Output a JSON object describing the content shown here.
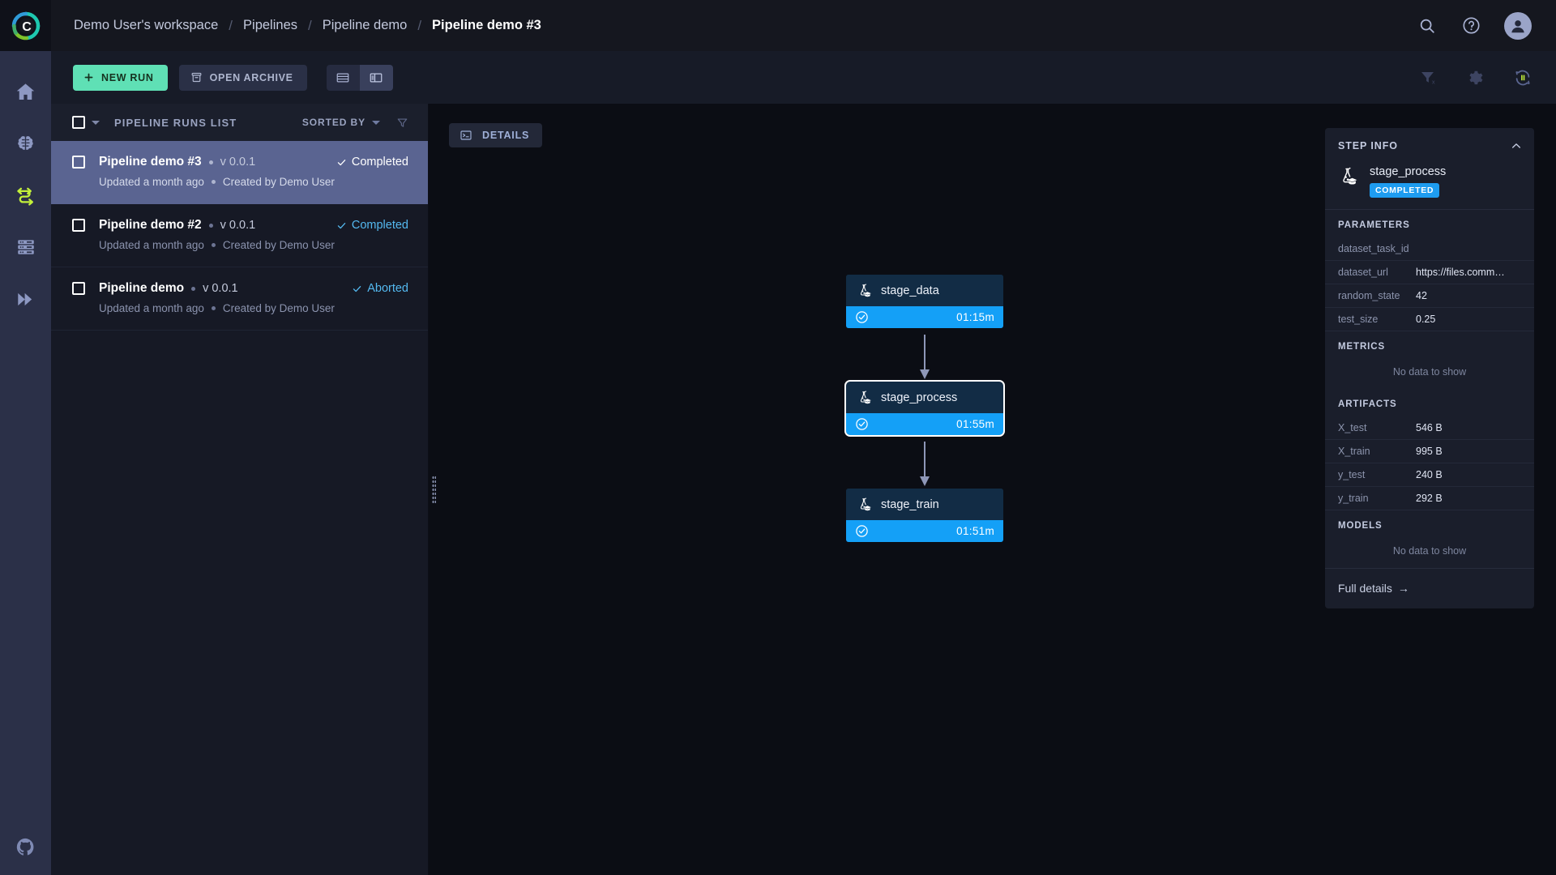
{
  "topbar": {
    "breadcrumb": [
      {
        "label": "Demo User's workspace",
        "current": false
      },
      {
        "label": "Pipelines",
        "current": false
      },
      {
        "label": "Pipeline demo",
        "current": false
      },
      {
        "label": "Pipeline demo #3",
        "current": true
      }
    ],
    "separator": "/",
    "icons": {
      "search": "search-icon",
      "help": "help-circle-icon",
      "avatar": "user-avatar"
    }
  },
  "rail": {
    "items": [
      {
        "name": "home",
        "icon": "home-icon",
        "active": false
      },
      {
        "name": "experiments",
        "icon": "brain-icon",
        "active": false
      },
      {
        "name": "pipelines",
        "icon": "pipelines-icon",
        "active": true
      },
      {
        "name": "datasets",
        "icon": "server-stack-icon",
        "active": false
      },
      {
        "name": "reports",
        "icon": "double-chevron-right-icon",
        "active": false
      }
    ],
    "bottom": {
      "name": "github",
      "icon": "github-icon"
    },
    "accent": "#c3f03a"
  },
  "toolbar": {
    "new_run_label": "NEW RUN",
    "open_archive_label": "OPEN ARCHIVE",
    "view_toggles": [
      {
        "name": "list-view",
        "icon": "list-view-icon",
        "active": false
      },
      {
        "name": "split-view",
        "icon": "split-view-icon",
        "active": true
      }
    ],
    "right_icons": [
      {
        "name": "clear-filters",
        "icon": "filter-off-icon"
      },
      {
        "name": "settings",
        "icon": "gear-icon"
      },
      {
        "name": "auto-refresh-pause",
        "icon": "refresh-pause-icon"
      }
    ],
    "new_run_color": "#5fe0b5"
  },
  "runs_panel": {
    "title": "PIPELINE RUNS LIST",
    "sorted_by_label": "SORTED BY",
    "filter_icon": "filter-icon",
    "items": [
      {
        "name": "Pipeline demo #3",
        "version": "v 0.0.1",
        "status": "Completed",
        "status_kind": "completed",
        "updated": "Updated a month ago",
        "created": "Created by Demo User",
        "selected": true
      },
      {
        "name": "Pipeline demo #2",
        "version": "v 0.0.1",
        "status": "Completed",
        "status_kind": "completed",
        "updated": "Updated a month ago",
        "created": "Created by Demo User",
        "selected": false
      },
      {
        "name": "Pipeline demo",
        "version": "v 0.0.1",
        "status": "Aborted",
        "status_kind": "aborted",
        "updated": "Updated a month ago",
        "created": "Created by Demo User",
        "selected": false
      }
    ]
  },
  "graph": {
    "details_label": "DETAILS",
    "details_icon": "console-icon",
    "nodes": [
      {
        "label": "stage_data",
        "duration": "01:15m",
        "status_icon": "check-circle-icon",
        "active": false
      },
      {
        "label": "stage_process",
        "duration": "01:55m",
        "status_icon": "check-circle-icon",
        "active": true
      },
      {
        "label": "stage_train",
        "duration": "01:51m",
        "status_icon": "check-circle-icon",
        "active": false
      }
    ],
    "node_status_color": "#14a0f7"
  },
  "step_info": {
    "panel_title": "STEP INFO",
    "collapse_icon": "chevron-up-icon",
    "step_name": "stage_process",
    "step_icon": "flask-graduation-icon",
    "badge": "COMPLETED",
    "badge_color": "#1e9cf0",
    "parameters_title": "PARAMETERS",
    "parameters": [
      {
        "key": "dataset_task_id",
        "value": ""
      },
      {
        "key": "dataset_url",
        "value": "https://files.comm…"
      },
      {
        "key": "random_state",
        "value": "42"
      },
      {
        "key": "test_size",
        "value": "0.25"
      }
    ],
    "metrics_title": "METRICS",
    "metrics_empty": "No data to show",
    "artifacts_title": "ARTIFACTS",
    "artifacts": [
      {
        "key": "X_test",
        "value": "546 B"
      },
      {
        "key": "X_train",
        "value": "995 B"
      },
      {
        "key": "y_test",
        "value": "240 B"
      },
      {
        "key": "y_train",
        "value": "292 B"
      }
    ],
    "models_title": "MODELS",
    "models_empty": "No data to show",
    "full_details_label": "Full details",
    "full_details_arrow": "→"
  }
}
